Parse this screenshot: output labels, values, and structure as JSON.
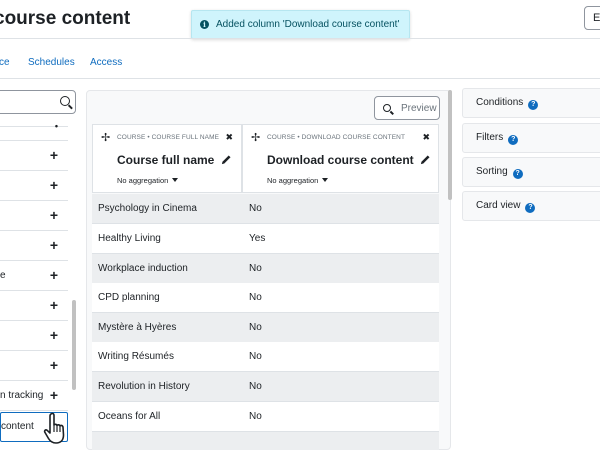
{
  "page": {
    "title": "course content",
    "edit_label": "Ed"
  },
  "toast": {
    "message": "Added column 'Download course content'",
    "icon": "info-icon"
  },
  "tabs": [
    {
      "label": "ce"
    },
    {
      "label": "Schedules"
    },
    {
      "label": "Access"
    }
  ],
  "sidebar": {
    "search_placeholder": "",
    "items": [
      {
        "label": "",
        "action": "+"
      },
      {
        "label": "",
        "action": "+"
      },
      {
        "label": "",
        "action": "+"
      },
      {
        "label": "",
        "action": "+"
      },
      {
        "label": "e",
        "action": "+"
      },
      {
        "label": "",
        "action": "+"
      },
      {
        "label": "",
        "action": "+"
      },
      {
        "label": "",
        "action": "+"
      },
      {
        "label": "n tracking",
        "action": "+"
      },
      {
        "label": "content",
        "action": ""
      }
    ]
  },
  "table": {
    "preview_label": "Preview",
    "columns": [
      {
        "kicker": "COURSE • COURSE FULL NAME",
        "name": "Course full name",
        "aggregation": "No aggregation",
        "move": "✢",
        "close": "✖"
      },
      {
        "kicker": "COURSE • DOWNLOAD COURSE CONTENT",
        "name": "Download course content",
        "aggregation": "No aggregation",
        "move": "✢",
        "close": "✖"
      }
    ],
    "rows": [
      [
        "Psychology in Cinema",
        "No"
      ],
      [
        "Healthy Living",
        "Yes"
      ],
      [
        "Workplace induction",
        "No"
      ],
      [
        "CPD planning",
        "No"
      ],
      [
        "Mystère à Hyères",
        "No"
      ],
      [
        "Writing Résumés",
        "No"
      ],
      [
        "Revolution in History",
        "No"
      ],
      [
        "Oceans for All",
        "No"
      ]
    ]
  },
  "right_panel": {
    "items": [
      {
        "label": "Conditions"
      },
      {
        "label": "Filters"
      },
      {
        "label": "Sorting"
      },
      {
        "label": "Card view"
      }
    ],
    "help_glyph": "?"
  },
  "colors": {
    "link": "#0f6cbf",
    "toast_bg": "#cff4fc",
    "toast_text": "#055160",
    "odd_row": "#eceef0"
  }
}
